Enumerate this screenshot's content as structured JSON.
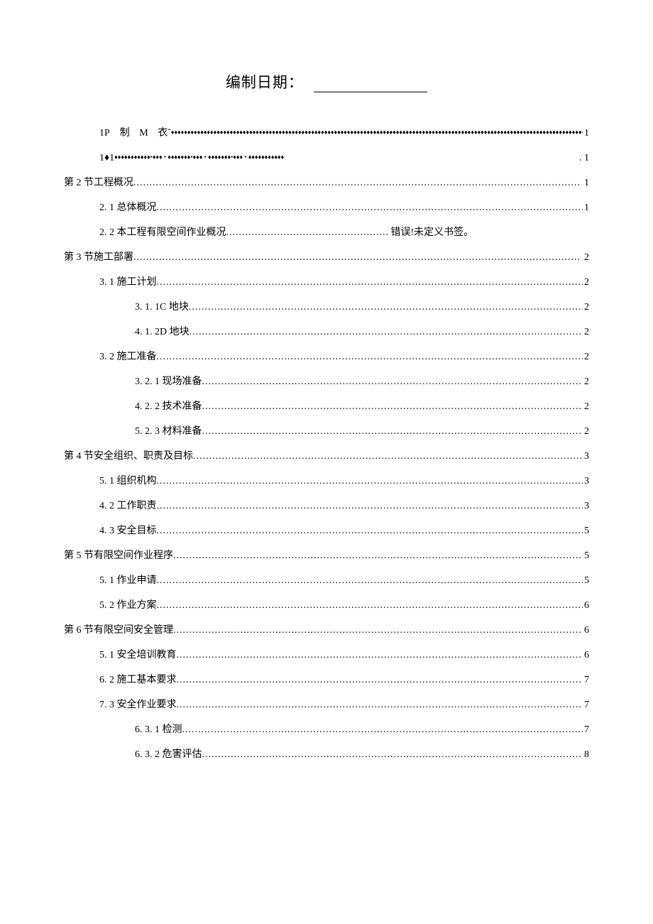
{
  "header": {
    "label": "编制日期："
  },
  "toc": [
    {
      "indent": 1,
      "text": "1P 制 M 衣ˆ",
      "page": "1",
      "leader": "diamond",
      "prefix_gap": true
    },
    {
      "indent": 1,
      "text": "1♦1",
      "page": ". 1",
      "leader": "diamond-groups"
    },
    {
      "indent": 0,
      "text": "第 2 节工程概况",
      "page": "1",
      "leader": "dots"
    },
    {
      "indent": 1,
      "text": "2. 1 总体概况",
      "page": "1",
      "leader": "dots"
    },
    {
      "indent": 1,
      "text": "2. 2 本工程有限空间作业概况",
      "page": "错误!未定义书签。",
      "leader": "dots-short"
    },
    {
      "indent": 0,
      "text": "第 3 节施工部署",
      "page": "2",
      "leader": "dots"
    },
    {
      "indent": 1,
      "text": "3. 1 施工计划",
      "page": "2",
      "leader": "dots"
    },
    {
      "indent": 2,
      "text": "3. 1. 1C 地块",
      "page": "2",
      "leader": "dots"
    },
    {
      "indent": 2,
      "text": "4. 1. 2D 地块",
      "page": "2",
      "leader": "dots"
    },
    {
      "indent": 1,
      "text": "3. 2 施工准备",
      "page": "2",
      "leader": "dots"
    },
    {
      "indent": 2,
      "text": "3. 2. 1 现场准备",
      "page": "2",
      "leader": "dots"
    },
    {
      "indent": 2,
      "text": "4. 2. 2 技术准备",
      "page": "2",
      "leader": "dots"
    },
    {
      "indent": 2,
      "text": "5. 2. 3 材料准备",
      "page": "2",
      "leader": "dots"
    },
    {
      "indent": 0,
      "text": "第 4 节安全组织、职责及目标",
      "page": "3",
      "leader": "dots"
    },
    {
      "indent": 1,
      "text": "5. 1  组织机构",
      "page": "3",
      "leader": "dots"
    },
    {
      "indent": 1,
      "text": "4. 2 工作职责",
      "page": "3",
      "leader": "dots"
    },
    {
      "indent": 1,
      "text": "4. 3 安全目标",
      "page": "5",
      "leader": "dots"
    },
    {
      "indent": 0,
      "text": "第 5 节有限空间作业程序",
      "page": "5",
      "leader": "dots"
    },
    {
      "indent": 1,
      "text": "5. 1 作业申请",
      "page": "5",
      "leader": "dots"
    },
    {
      "indent": 1,
      "text": "5. 2 作业方案",
      "page": "6",
      "leader": "dots"
    },
    {
      "indent": 0,
      "text": "第 6 节有限空间安全管理",
      "page": "6",
      "leader": "dots"
    },
    {
      "indent": 1,
      "text": "5. 1  安全培训教育",
      "page": "6",
      "leader": "dots"
    },
    {
      "indent": 1,
      "text": "6. 2 施工基本要求",
      "page": "7",
      "leader": "dots"
    },
    {
      "indent": 1,
      "text": "7. 3 安全作业要求",
      "page": "7",
      "leader": "dots"
    },
    {
      "indent": 2,
      "text": "6. 3. 1 检测",
      "page": "7",
      "leader": "dots"
    },
    {
      "indent": 2,
      "text": "6. 3. 2 危害评估",
      "page": "8",
      "leader": "dots"
    }
  ],
  "leaders": {
    "dots": "............................................................................................................................................",
    "diamond": "♦♦♦♦♦♦♦♦♦♦♦♦♦♦♦♦♦♦♦♦♦♦♦♦♦♦♦♦♦♦♦♦♦♦♦♦♦♦♦♦♦♦♦♦♦♦♦♦♦♦♦♦♦♦♦♦♦♦♦♦♦♦♦♦♦♦♦♦♦♦♦♦♦♦♦♦♦♦♦♦♦♦♦♦♦♦♦♦♦♦♦♦♦♦♦♦♦♦♦♦♦♦♦♦♦♦♦♦♦♦♦♦♦♦♦♦♦♦♦♦♦♦♦♦♦♦♦♦♦♦♦♦♦♦♦♦♦♦♦♦♦♦♦♦♦♦♦♦♦♦",
    "diamond_groups": "♦♦♦♦♦♦♦♦♦♦♦•♦♦♦ • ♦♦♦♦♦♦♦•♦♦♦ • ♦♦♦♦♦♦♦•♦♦♦ • ♦♦♦♦♦♦♦♦♦♦♦"
  }
}
